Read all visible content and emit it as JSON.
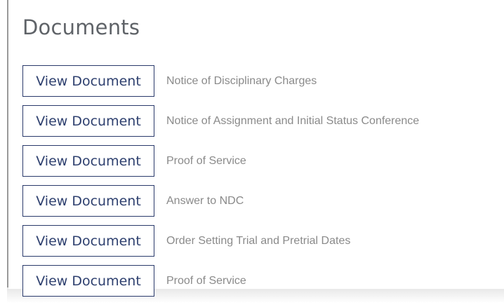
{
  "section": {
    "title": "Documents"
  },
  "documents": [
    {
      "button_label": "View Document",
      "title": "Notice of Disciplinary Charges"
    },
    {
      "button_label": "View Document",
      "title": "Notice of Assignment and Initial Status Conference"
    },
    {
      "button_label": "View Document",
      "title": "Proof of Service"
    },
    {
      "button_label": "View Document",
      "title": "Answer to NDC"
    },
    {
      "button_label": "View Document",
      "title": "Order Setting Trial and Pretrial Dates"
    },
    {
      "button_label": "View Document",
      "title": "Proof of Service"
    }
  ]
}
